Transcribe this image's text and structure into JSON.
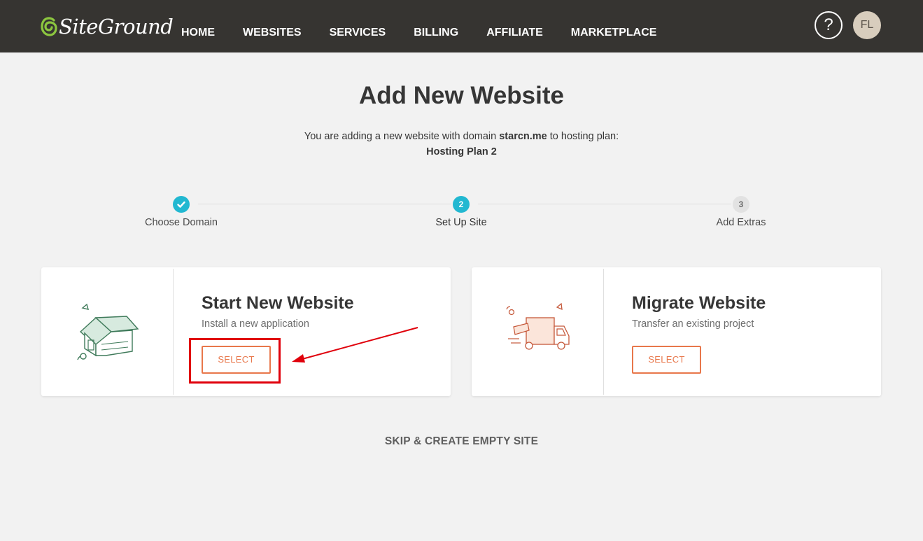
{
  "header": {
    "logo_text": "SiteGround",
    "nav": [
      "HOME",
      "WEBSITES",
      "SERVICES",
      "BILLING",
      "AFFILIATE",
      "MARKETPLACE"
    ],
    "help_label": "?",
    "avatar_initials": "FL"
  },
  "page": {
    "title": "Add New Website",
    "subtitle_prefix": "You are adding a new website with domain",
    "domain": "starcn.me",
    "subtitle_suffix": "to hosting plan:",
    "plan_name": "Hosting Plan 2"
  },
  "stepper": {
    "steps": [
      {
        "number": "",
        "label": "Choose Domain",
        "state": "done"
      },
      {
        "number": "2",
        "label": "Set Up Site",
        "state": "active"
      },
      {
        "number": "3",
        "label": "Add Extras",
        "state": "pending"
      }
    ]
  },
  "cards": [
    {
      "title": "Start New Website",
      "description": "Install a new application",
      "button": "SELECT",
      "icon": "house-icon"
    },
    {
      "title": "Migrate Website",
      "description": "Transfer an existing project",
      "button": "SELECT",
      "icon": "moving-truck-icon"
    }
  ],
  "skip_label": "SKIP & CREATE EMPTY SITE",
  "colors": {
    "header_bg": "#363431",
    "accent_orange": "#e8774b",
    "step_blue": "#22b8d1",
    "logo_green": "#8cc63f",
    "annotation_red": "#e0000b"
  }
}
